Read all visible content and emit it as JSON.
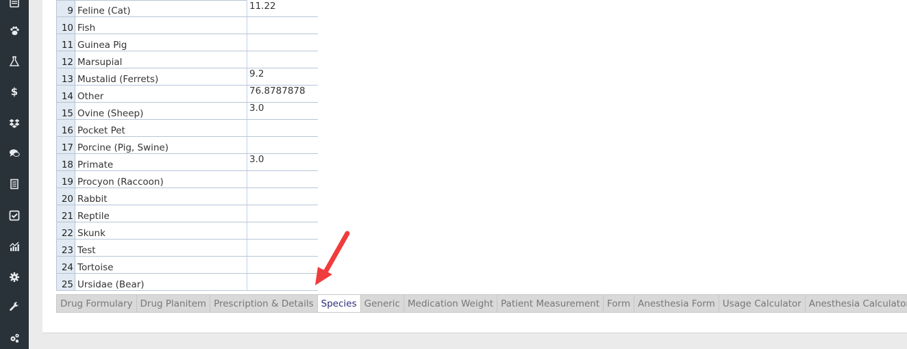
{
  "sidebar": {
    "icons": [
      "list-icon",
      "paw-icon",
      "flask-icon",
      "dollar-icon",
      "dropbox-icon",
      "comments-icon",
      "document-icon",
      "checkbox-icon",
      "chart-icon",
      "gear-icon",
      "wrench-icon",
      "cogs-icon"
    ],
    "dollar_glyph": "$"
  },
  "grid": {
    "rows": [
      {
        "num": "9",
        "species": "Feline (Cat)",
        "value": "11.22"
      },
      {
        "num": "10",
        "species": "Fish",
        "value": ""
      },
      {
        "num": "11",
        "species": "Guinea Pig",
        "value": ""
      },
      {
        "num": "12",
        "species": "Marsupial",
        "value": ""
      },
      {
        "num": "13",
        "species": "Mustalid (Ferrets)",
        "value": "9.2"
      },
      {
        "num": "14",
        "species": "Other",
        "value": "76.8787878"
      },
      {
        "num": "15",
        "species": "Ovine (Sheep)",
        "value": "3.0"
      },
      {
        "num": "16",
        "species": "Pocket Pet",
        "value": ""
      },
      {
        "num": "17",
        "species": "Porcine (Pig, Swine)",
        "value": ""
      },
      {
        "num": "18",
        "species": "Primate",
        "value": "3.0"
      },
      {
        "num": "19",
        "species": "Procyon (Raccoon)",
        "value": ""
      },
      {
        "num": "20",
        "species": "Rabbit",
        "value": ""
      },
      {
        "num": "21",
        "species": "Reptile",
        "value": ""
      },
      {
        "num": "22",
        "species": "Skunk",
        "value": ""
      },
      {
        "num": "23",
        "species": "Test",
        "value": ""
      },
      {
        "num": "24",
        "species": "Tortoise",
        "value": ""
      },
      {
        "num": "25",
        "species": "Ursidae (Bear)",
        "value": ""
      }
    ]
  },
  "tabs": [
    {
      "label": "Drug Formulary",
      "active": false
    },
    {
      "label": "Drug Planitem",
      "active": false
    },
    {
      "label": "Prescription & Details",
      "active": false
    },
    {
      "label": "Species",
      "active": true
    },
    {
      "label": "Generic",
      "active": false
    },
    {
      "label": "Medication Weight",
      "active": false
    },
    {
      "label": "Patient Measurement",
      "active": false
    },
    {
      "label": "Form",
      "active": false
    },
    {
      "label": "Anesthesia Form",
      "active": false
    },
    {
      "label": "Usage Calculator",
      "active": false
    },
    {
      "label": "Anesthesia Calculator",
      "active": false
    }
  ],
  "colors": {
    "sidebar": "#2a3239",
    "active_tab_text": "#2b2b7a",
    "annotation_arrow": "#f03c3c"
  }
}
